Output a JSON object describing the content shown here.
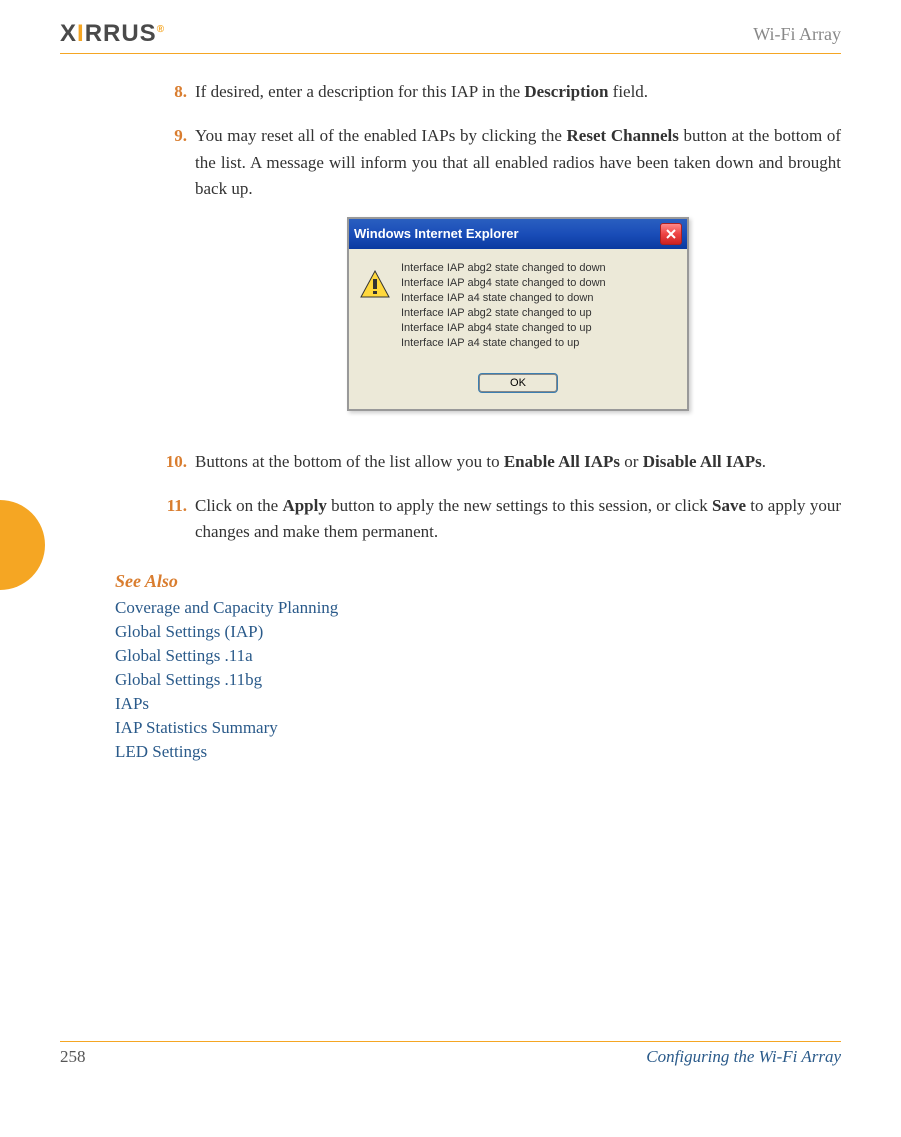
{
  "header": {
    "logo_text_1": "X",
    "logo_text_2": "I",
    "logo_text_3": "RRUS",
    "right": "Wi-Fi Array"
  },
  "items": {
    "i8": {
      "num": "8.",
      "pre": "If desired, enter a description for this IAP in the ",
      "bold": "Description",
      "post": " field."
    },
    "i9": {
      "num": "9.",
      "pre": "You may reset all of the enabled IAPs by clicking the ",
      "bold": "Reset Channels",
      "post": " button at the bottom of the list. A message will inform you that all enabled radios have been taken down and brought back up."
    },
    "i10": {
      "num": "10.",
      "pre": "Buttons at the bottom of the list allow you to ",
      "bold1": "Enable All IAPs",
      "mid": " or ",
      "bold2": "Disable All IAPs",
      "post": "."
    },
    "i11": {
      "num": "11.",
      "pre": "Click on the ",
      "bold1": "Apply",
      "mid": " button to apply the new settings to this session, or click ",
      "bold2": "Save",
      "post": " to apply your changes and make them permanent."
    }
  },
  "dialog": {
    "title": "Windows Internet Explorer",
    "lines": {
      "l1": "Interface IAP abg2 state changed to down",
      "l2": "Interface IAP abg4 state changed to down",
      "l3": "Interface IAP a4 state changed to down",
      "l4": "Interface IAP abg2 state changed to up",
      "l5": "Interface IAP abg4 state changed to up",
      "l6": "Interface IAP a4 state changed to up"
    },
    "ok": "OK"
  },
  "see_also": {
    "title": "See Also",
    "links": {
      "l1": "Coverage and Capacity Planning",
      "l2": "Global Settings (IAP)",
      "l3": "Global Settings .11a",
      "l4": "Global Settings .11bg",
      "l5": "IAPs",
      "l6": "IAP Statistics Summary",
      "l7": "LED Settings"
    }
  },
  "footer": {
    "page": "258",
    "right": "Configuring the Wi-Fi Array"
  }
}
